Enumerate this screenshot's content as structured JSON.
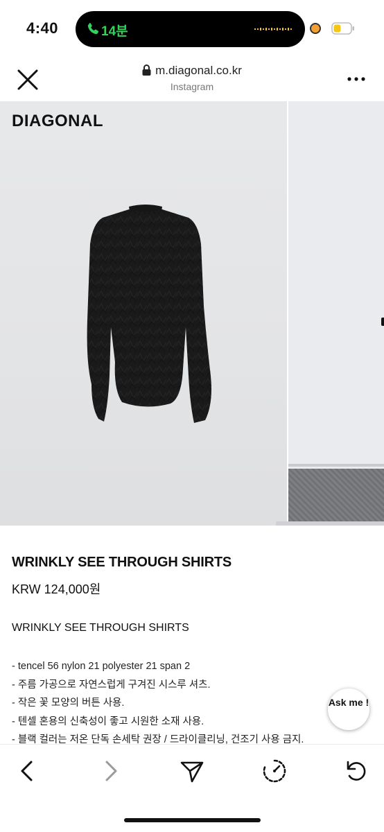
{
  "status_bar": {
    "time": "4:40",
    "call_duration": "14분",
    "call_color": "#35d15a",
    "recording_dot_color": "#f2a033",
    "battery_color": "#f5c518"
  },
  "browser": {
    "url": "m.diagonal.co.kr",
    "source": "Instagram",
    "close_icon": "close-icon",
    "more_icon": "more-icon"
  },
  "gallery": {
    "brand": "DIAGONAL",
    "shirt_color": "#1a1a1a"
  },
  "product": {
    "title": "WRINKLY SEE THROUGH SHIRTS",
    "price": "KRW 124,000원",
    "subtitle": "WRINKLY SEE THROUGH SHIRTS",
    "description": [
      "- tencel 56 nylon 21 polyester 21 span 2",
      "- 주름 가공으로 자연스럽게 구겨진 시스루 셔츠.",
      "- 작은 꽃 모양의 버튼 사용.",
      "- 텐셀 혼용의 신축성이 좋고 시원한 소재 사용.",
      "- 블랙 컬러는 저온 단독 손세탁 권장 / 드라이클리닝, 건조기 사용 금지."
    ]
  },
  "ask_button": {
    "label": "Ask me !"
  },
  "toolbar": {
    "back_icon": "back-arrow-icon",
    "forward_icon": "forward-arrow-icon",
    "share_icon": "share-icon",
    "speed_icon": "speedometer-icon",
    "reload_icon": "reload-icon"
  }
}
